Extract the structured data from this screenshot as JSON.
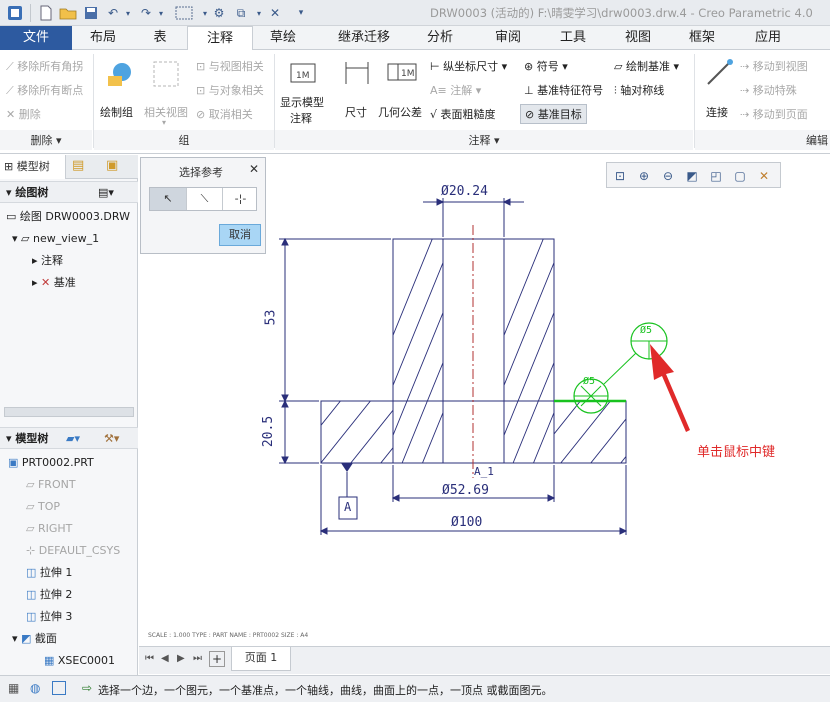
{
  "titlebar": {
    "title": "DRW0003 (活动的) F:\\晴雯学习\\drw0003.drw.4 - Creo Parametric 4.0"
  },
  "tabs": [
    {
      "label": "文件"
    },
    {
      "label": "布局"
    },
    {
      "label": "表"
    },
    {
      "label": "注释"
    },
    {
      "label": "草绘"
    },
    {
      "label": "继承迁移"
    },
    {
      "label": "分析"
    },
    {
      "label": "审阅"
    },
    {
      "label": "工具"
    },
    {
      "label": "视图"
    },
    {
      "label": "框架"
    },
    {
      "label": "应用"
    }
  ],
  "ribbon": {
    "delete_group": {
      "remove_all_angles": "移除所有角拐",
      "remove_all_breakpoints": "移除所有断点",
      "delete": "删除",
      "label": "删除"
    },
    "group_group": {
      "draw_group": "绘制组",
      "related_view": "相关视图",
      "relate_to_view": "与视图相关",
      "relate_to_object": "与对象相关",
      "cancel_related": "取消相关",
      "label": "组"
    },
    "annotation_group": {
      "show_model_annotation_line1": "显示模型",
      "show_model_annotation_line2": "注释",
      "dimension": "尺寸",
      "geometric_tolerance": "几何公差",
      "ordinate_dimension": "纵坐标尺寸",
      "note": "注解",
      "surface_roughness": "表面粗糙度",
      "symbol": "符号",
      "datum_feature_symbol": "基准特征符号",
      "datum_target": "基准目标",
      "draw_datum": "绘制基准",
      "axis_of_symmetry": "轴对称线",
      "label": "注释"
    },
    "edit_group": {
      "connect": "连接",
      "move_to_view": "移动到视图",
      "move_special": "移动特殊",
      "move_to_page": "移动到页面",
      "label": "编辑"
    }
  },
  "left_panel": {
    "tab_model_tree": "模型树",
    "drawing_tree_header": "绘图树",
    "drawing_items": [
      {
        "label": "绘图 DRW0003.DRW"
      },
      {
        "label": "new_view_1"
      },
      {
        "label": "注释"
      },
      {
        "label": "基准"
      }
    ],
    "model_tree_header": "模型树",
    "model_items": [
      {
        "label": "PRT0002.PRT"
      },
      {
        "label": "FRONT"
      },
      {
        "label": "TOP"
      },
      {
        "label": "RIGHT"
      },
      {
        "label": "DEFAULT_CSYS"
      },
      {
        "label": "拉伸 1"
      },
      {
        "label": "拉伸 2"
      },
      {
        "label": "拉伸 3"
      },
      {
        "label": "截面"
      },
      {
        "label": "XSEC0001"
      }
    ]
  },
  "dialog": {
    "title": "选择参考",
    "cancel": "取消"
  },
  "drawing": {
    "dim_top": "Ø20.24",
    "dim_53": "53",
    "dim_20_5": "20.5",
    "dim_52_69": "Ø52.69",
    "dim_100": "Ø100",
    "datum_label": "A",
    "axis_label": "A_1",
    "target_label": "Ø5",
    "annotation": "单击鼠标中键",
    "footer_info": "SCALE : 1.000   TYPE : PART   NAME : PRT0002   SIZE : A4",
    "colors": {
      "line": "#2a2f7a",
      "green": "#18c21f",
      "arrow": "#e02a2a"
    }
  },
  "sheet": {
    "page_tab": "页面 1"
  },
  "status": {
    "message": "选择一个边，一个图元，一个基准点，一个轴线，曲线，曲面上的一点，一顶点 或截面图元。"
  }
}
